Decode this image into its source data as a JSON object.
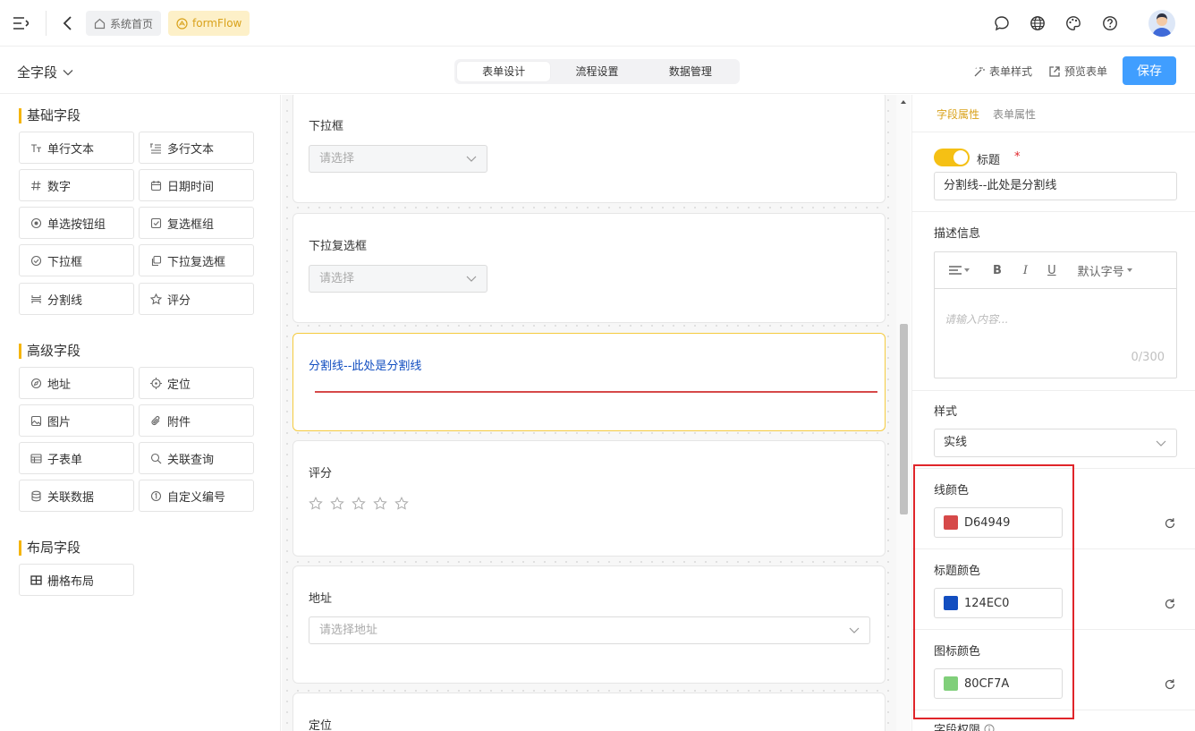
{
  "topbar": {
    "home_tag": "系统首页",
    "flow_tag": "formFlow"
  },
  "subbar": {
    "field_selector": "全字段",
    "tabs": [
      "表单设计",
      "流程设置",
      "数据管理"
    ],
    "active_tab": "表单设计",
    "form_style": "表单样式",
    "preview": "预览表单",
    "save": "保存"
  },
  "left_panel": {
    "basic_title": "基础字段",
    "basic_fields": [
      "单行文本",
      "多行文本",
      "数字",
      "日期时间",
      "单选按钮组",
      "复选框组",
      "下拉框",
      "下拉复选框",
      "分割线",
      "评分"
    ],
    "advanced_title": "高级字段",
    "advanced_fields": [
      "地址",
      "定位",
      "图片",
      "附件",
      "子表单",
      "关联查询",
      "关联数据",
      "自定义编号"
    ],
    "layout_title": "布局字段",
    "layout_fields": [
      "栅格布局"
    ]
  },
  "canvas": {
    "dropdown": {
      "label": "下拉框",
      "placeholder": "请选择"
    },
    "multi_dropdown": {
      "label": "下拉复选框",
      "placeholder": "请选择"
    },
    "divider": {
      "label": "分割线--此处是分割线"
    },
    "rating": {
      "label": "评分",
      "star_count": 5,
      "value": 0
    },
    "address": {
      "label": "地址",
      "placeholder": "请选择地址"
    },
    "location": {
      "label": "定位"
    }
  },
  "right_panel": {
    "tabs": [
      "字段属性",
      "表单属性"
    ],
    "active_tab": "字段属性",
    "title_label": "标题",
    "title_required_mark": "*",
    "title_value": "分割线--此处是分割线",
    "description_label": "描述信息",
    "editor_font_size": "默认字号",
    "editor_bold": "B",
    "editor_italic": "I",
    "editor_underline": "U",
    "editor_placeholder": "请输入内容...",
    "editor_counter": "0/300",
    "style_label": "样式",
    "style_value": "实线",
    "line_color_label": "线颜色",
    "line_color_value": "D64949",
    "title_color_label": "标题颜色",
    "title_color_value": "124EC0",
    "icon_color_label": "图标颜色",
    "icon_color_value": "80CF7A",
    "permission_label": "字段权限"
  },
  "colors": {
    "accent": "#f5c014",
    "primary": "#409eff",
    "line_color": "#D64949",
    "title_color": "#124EC0",
    "icon_color": "#80CF7A",
    "highlight_box": "#e0252a"
  }
}
